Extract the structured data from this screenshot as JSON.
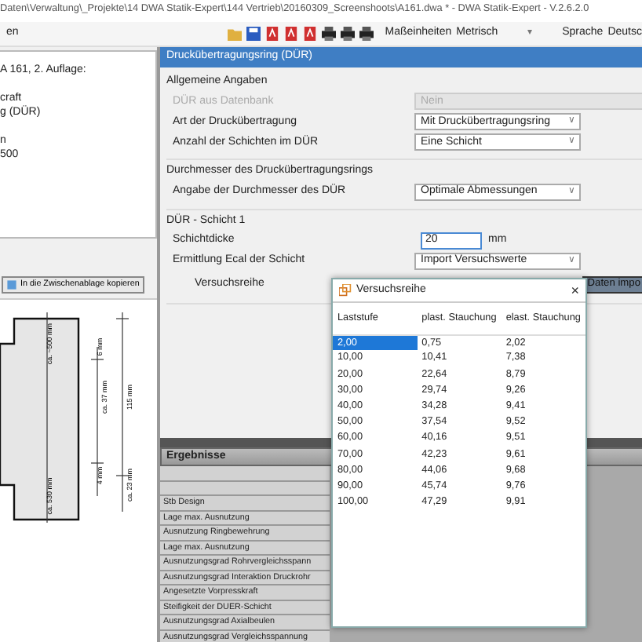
{
  "title_bar": {
    "title": "Daten\\Verwaltung\\_Projekte\\14 DWA Statik-Expert\\144 Vertrieb\\20160309_Screenshoots\\A161.dwa * - DWA Statik-Expert - V.2.6.2.0"
  },
  "menu": {
    "label": "en"
  },
  "toolbar": {
    "units_label": "Maßeinheiten",
    "units_value": "Metrisch",
    "units_caret": "▾",
    "language_label": "Sprache",
    "language_value": "Deutsc"
  },
  "info_panel": {
    "groups": [
      [
        "A 161, 2. Auflage:"
      ],
      [
        "craft",
        "g (DÜR)"
      ],
      [
        "n",
        "500"
      ]
    ]
  },
  "copy_button": {
    "label": "In die Zwischenablage kopieren"
  },
  "drawing": {
    "labels": [
      "ca. ~500 mm",
      "6 mm",
      "ca. 37 mm",
      "115 mm",
      "ca. 530 mm",
      "4 mm",
      "ca. 23 mm"
    ]
  },
  "form": {
    "title": "Druckübertragungsring (DÜR)",
    "sections": [
      {
        "heading": "Allgemeine Angaben",
        "rows": [
          {
            "label": "DÜR aus Datenbank",
            "kind": "readonly",
            "value": "Nein",
            "disabled": true
          },
          {
            "label": "Art der Druckübertragung",
            "kind": "select",
            "value": "Mit Druckübertragungsring",
            "caret": "∨"
          },
          {
            "label": "Anzahl der Schichten im DÜR",
            "kind": "select",
            "value": "Eine Schicht",
            "caret": "∨"
          }
        ]
      },
      {
        "heading": "Durchmesser des Druckübertragungsrings",
        "rows": [
          {
            "label": "Angabe der Durchmesser des DÜR",
            "kind": "select",
            "value": "Optimale Abmessungen",
            "caret": "∨"
          }
        ]
      },
      {
        "heading": "DÜR - Schicht 1",
        "rows": [
          {
            "label": "Schichtdicke",
            "kind": "number",
            "value": "20",
            "unit": "mm"
          },
          {
            "label": "Ermittlung Ecal der Schicht",
            "kind": "select",
            "value": "Import Versuchswerte",
            "caret": "∨"
          },
          {
            "label": "Versuchsreihe",
            "kind": "import",
            "button": "Daten impo"
          }
        ]
      }
    ]
  },
  "results": {
    "heading": "Ergebnisse",
    "rows": [
      "Stb Design",
      "Lage max. Ausnutzung",
      "Ausnutzung Ringbewehrung",
      "Lage max. Ausnutzung",
      "Ausnutzungsgrad Rohrvergleichsspann",
      "Ausnutzungsgrad Interaktion Druckrohr",
      "Angesetzte Vorpresskraft",
      "Steifigkeit der DUER-Schicht",
      "Ausnutzungsgrad Axialbeulen",
      "Ausnutzungsgrad Vergleichsspannung"
    ]
  },
  "dialog": {
    "title": "Versuchsreihe",
    "close": "×",
    "columns": [
      "Laststufe",
      "plast. Stauchung",
      "elast. Stauchung"
    ],
    "rows": [
      {
        "cells": [
          "2,00",
          "0,75",
          "2,02"
        ],
        "selected": true
      },
      {
        "cells": [
          "10,00",
          "10,41",
          "7,38"
        ],
        "selected": false
      },
      {
        "cells": [
          "20,00",
          "22,64",
          "8,79"
        ],
        "selected": false
      },
      {
        "cells": [
          "30,00",
          "29,74",
          "9,26"
        ],
        "selected": false
      },
      {
        "cells": [
          "40,00",
          "34,28",
          "9,41"
        ],
        "selected": false
      },
      {
        "cells": [
          "50,00",
          "37,54",
          "9,52"
        ],
        "selected": false
      },
      {
        "cells": [
          "60,00",
          "40,16",
          "9,51"
        ],
        "selected": false
      },
      {
        "cells": [
          "70,00",
          "42,23",
          "9,61"
        ],
        "selected": false
      },
      {
        "cells": [
          "80,00",
          "44,06",
          "9,68"
        ],
        "selected": false
      },
      {
        "cells": [
          "90,00",
          "45,74",
          "9,76"
        ],
        "selected": false
      },
      {
        "cells": [
          "100,00",
          "47,29",
          "9,91"
        ],
        "selected": false
      }
    ]
  }
}
